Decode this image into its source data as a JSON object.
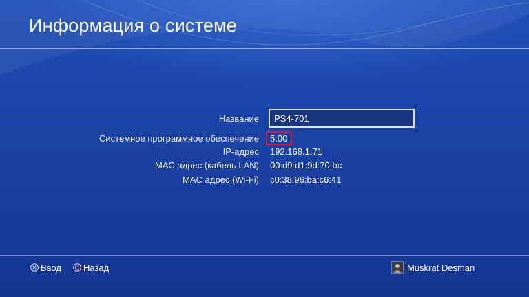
{
  "header": {
    "title": "Информация о системе"
  },
  "system_info": {
    "rows": [
      {
        "label": "Название",
        "value": "PS4-701"
      },
      {
        "label": "Системное программное обеспечение",
        "value": "5.00"
      },
      {
        "label": "IP-адрес",
        "value": "192.168.1.71"
      },
      {
        "label": "MAC адрес (кабель LAN)",
        "value": "00:d9:d1:9d:70:bc"
      },
      {
        "label": "MAC адрес (Wi-Fi)",
        "value": "c0:38:96:ba:c6:41"
      }
    ]
  },
  "footer": {
    "enter_label": "Ввод",
    "enter_icon": "cross-button-icon",
    "back_label": "Назад",
    "back_icon": "circle-button-icon",
    "user_name": "Muskrat Desman"
  },
  "colors": {
    "background": "#1b44a8",
    "highlight": "#e01a2a",
    "text": "#ffffff"
  }
}
